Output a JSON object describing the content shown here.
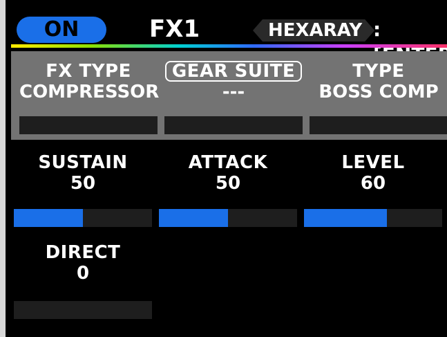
{
  "header": {
    "status_label": "ON",
    "title": "FX1",
    "model_label": "HEXARAY",
    "enter_hint": ":[ENTER]"
  },
  "params_top": [
    {
      "label": "FX TYPE",
      "value": "COMPRESSOR",
      "boxed": false
    },
    {
      "label": "GEAR SUITE",
      "value": "---",
      "boxed": true
    },
    {
      "label": "TYPE",
      "value": "BOSS COMP",
      "boxed": false
    }
  ],
  "params": [
    {
      "label": "SUSTAIN",
      "value": "50",
      "level": 0.5
    },
    {
      "label": "ATTACK",
      "value": "50",
      "level": 0.5
    },
    {
      "label": "LEVEL",
      "value": "60",
      "level": 0.6
    },
    {
      "label": "DIRECT",
      "value": "0",
      "level": 0.0
    }
  ],
  "colors": {
    "accent_blue": "#1a6fe8",
    "band_gray": "#737373",
    "background": "#000000"
  }
}
